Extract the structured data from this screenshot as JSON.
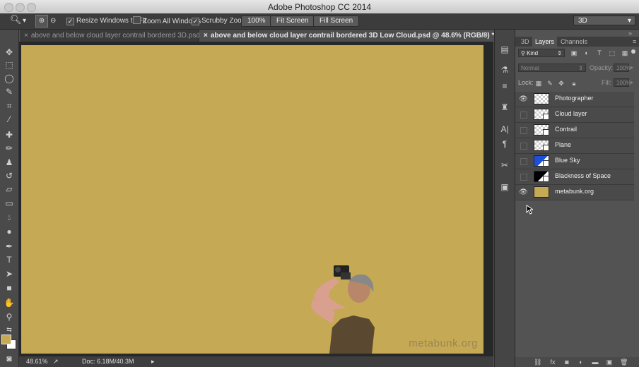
{
  "window": {
    "title": "Adobe Photoshop CC 2014"
  },
  "options_bar": {
    "resize_windows": "Resize Windows to Fit",
    "zoom_all": "Zoom All Windows",
    "scrubby": "Scrubby Zoom",
    "zoom_value": "100%",
    "fit_screen": "Fit Screen",
    "fill_screen": "Fill Screen",
    "workspace": "3D"
  },
  "tabs": [
    {
      "label": "above and below cloud layer contrail bordered  3D.psd"
    },
    {
      "label": "above and below cloud layer contrail bordered  3D  Low Cloud.psd @ 48.6% (RGB/8) *"
    }
  ],
  "canvas": {
    "watermark": "metabunk.org",
    "fill_color": "#c5a954"
  },
  "status": {
    "zoom": "48.61%",
    "doc": "Doc: 6.18M/40.3M"
  },
  "panel": {
    "tabs": [
      "3D",
      "Layers",
      "Channels"
    ],
    "filter": "Kind",
    "blend_mode": "Normal",
    "opacity_label": "Opacity:",
    "opacity_value": "100%",
    "lock_label": "Lock:",
    "fill_label": "Fill:",
    "fill_value": "100%",
    "layers": [
      {
        "name": "Photographer",
        "visible": true
      },
      {
        "name": "Cloud layer",
        "visible": false
      },
      {
        "name": "Contrail",
        "visible": false
      },
      {
        "name": "Plane",
        "visible": false
      },
      {
        "name": "Blue Sky",
        "visible": false
      },
      {
        "name": "Blackness of Space",
        "visible": false
      },
      {
        "name": "metabunk.org",
        "visible": true
      }
    ]
  }
}
